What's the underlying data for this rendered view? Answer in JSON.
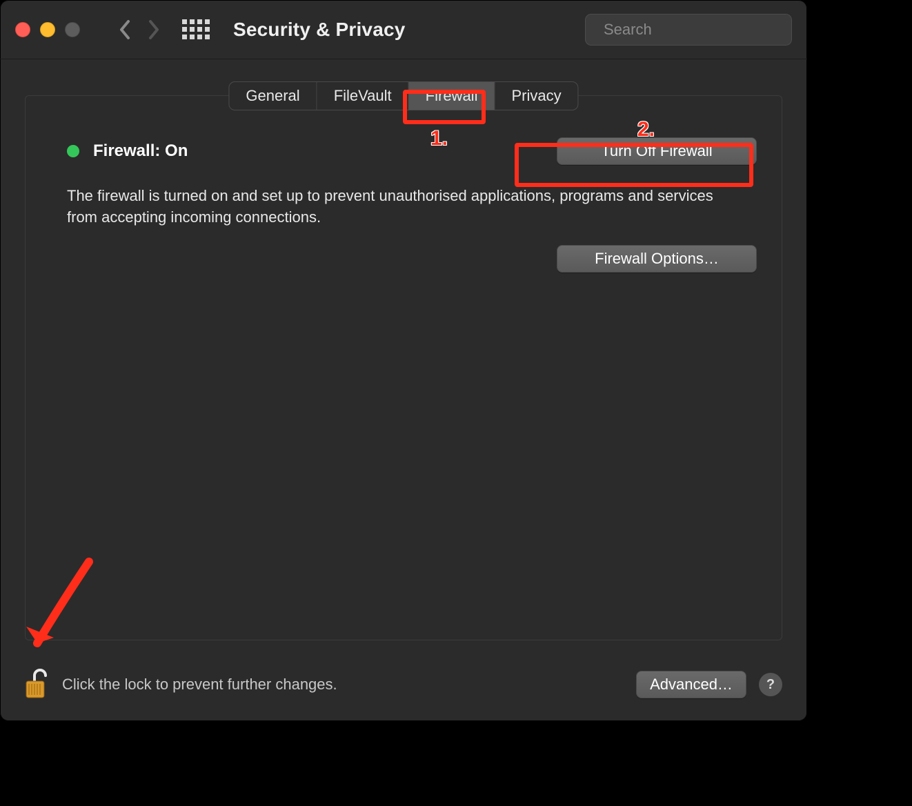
{
  "toolbar": {
    "title": "Security & Privacy",
    "search_placeholder": "Search"
  },
  "tabs": {
    "items": [
      {
        "label": "General"
      },
      {
        "label": "FileVault"
      },
      {
        "label": "Firewall"
      },
      {
        "label": "Privacy"
      }
    ],
    "selected_index": 2
  },
  "firewall": {
    "status_label": "Firewall: On",
    "status_color": "#34c759",
    "description": "The firewall is turned on and set up to prevent unauthorised applications, programs and services from accepting incoming connections.",
    "turn_off_label": "Turn Off Firewall",
    "options_label": "Firewall Options…"
  },
  "footer": {
    "lock_text": "Click the lock to prevent further changes.",
    "advanced_label": "Advanced…",
    "help_label": "?"
  },
  "annotations": {
    "num1": "1.",
    "num2": "2."
  }
}
